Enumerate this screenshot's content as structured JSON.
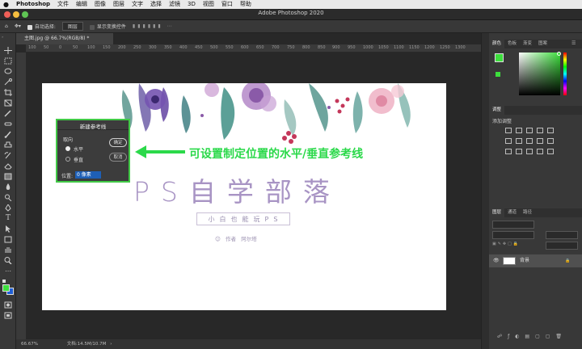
{
  "menubar": {
    "apple": "",
    "app": "Photoshop",
    "items": [
      "文件",
      "编辑",
      "图像",
      "图层",
      "文字",
      "选择",
      "滤镜",
      "3D",
      "视图",
      "窗口",
      "帮助"
    ]
  },
  "titlebar": {
    "title": "Adobe Photoshop 2020"
  },
  "options": {
    "auto_select_label": "自动选择:",
    "auto_select_value": "图层",
    "transform_label": "显示变换控件"
  },
  "document": {
    "tab_label": "主图.jpg @ 66.7%(RGB/8) *",
    "ruler_marks": [
      "100",
      "50",
      "0",
      "50",
      "100",
      "150",
      "200",
      "250",
      "300",
      "350",
      "400",
      "450",
      "500",
      "550",
      "600",
      "650",
      "700",
      "750",
      "800",
      "850",
      "900",
      "950",
      "1000",
      "1050",
      "1100",
      "1150",
      "1200",
      "1250",
      "1300"
    ]
  },
  "canvas": {
    "title": "PS自学部落",
    "subtitle": "小白也能玩PS",
    "author_label": "作者",
    "author_name": "阿尔塔"
  },
  "annotation": {
    "text": "可设置制定位置的水平/垂直参考线",
    "color": "#2bd94a"
  },
  "dialog": {
    "title": "新建参考线",
    "orientation_label": "取向",
    "horizontal_label": "水平",
    "vertical_label": "垂直",
    "position_label": "位置:",
    "position_value": "0 像素",
    "ok_label": "确定",
    "cancel_label": "取消",
    "selected": "horizontal"
  },
  "status": {
    "zoom": "66.67%",
    "doc_info": "文档:14.5M/10.7M"
  },
  "panels": {
    "color_tabs": [
      "颜色",
      "色板",
      "渐变",
      "图案"
    ],
    "adjust_tabs": [
      "调整"
    ],
    "adjust_label": "添加调整",
    "layers_tabs": [
      "图层",
      "通道",
      "路径"
    ],
    "background_layer": "背景"
  },
  "colors": {
    "foreground": "#3ddf3d",
    "background": "#1f5fd6",
    "title_purple": "#a894c4"
  }
}
